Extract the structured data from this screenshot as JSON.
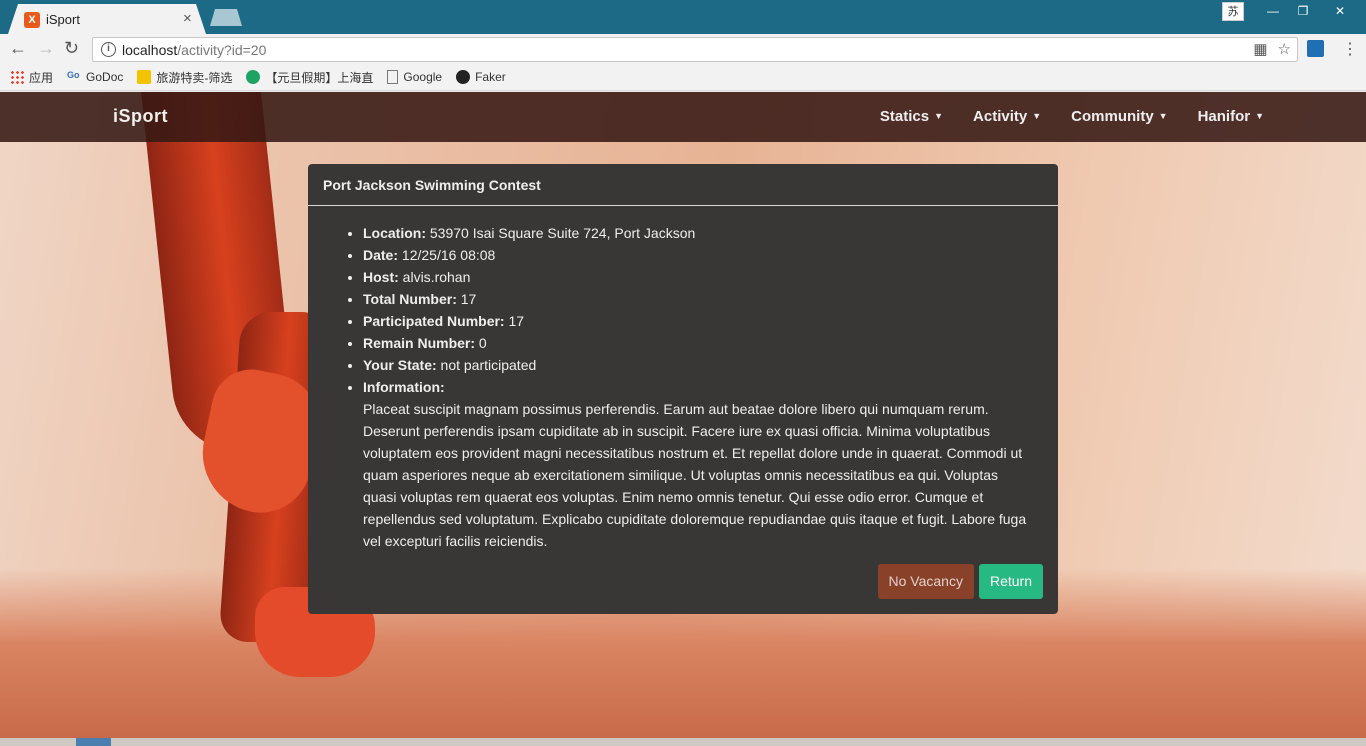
{
  "browser": {
    "tab_title": "iSport",
    "tab_favicon": "X",
    "tab_close": "×",
    "ime_label": "苏",
    "url_host": "localhost",
    "url_path": "/activity?id=20",
    "bookmarks": [
      {
        "label": "应用",
        "icon": "apps-grid-icon"
      },
      {
        "label": "GoDoc",
        "icon": "godoc-icon"
      },
      {
        "label": "旅游特卖-筛选",
        "icon": "travel-icon"
      },
      {
        "label": "【元旦假期】上海直",
        "icon": "green-icon"
      },
      {
        "label": "Google",
        "icon": "page-icon"
      },
      {
        "label": "Faker",
        "icon": "github-icon"
      }
    ]
  },
  "navbar": {
    "brand": "iSport",
    "items": [
      "Statics",
      "Activity",
      "Community",
      "Hanifor"
    ]
  },
  "panel": {
    "title": "Port Jackson Swimming Contest",
    "details": [
      {
        "label": "Location:",
        "value": "53970 Isai Square Suite 724, Port Jackson"
      },
      {
        "label": "Date:",
        "value": "12/25/16 08:08"
      },
      {
        "label": "Host:",
        "value": "alvis.rohan"
      },
      {
        "label": "Total Number:",
        "value": "17"
      },
      {
        "label": "Participated Number:",
        "value": "17"
      },
      {
        "label": "Remain Number:",
        "value": "0"
      },
      {
        "label": "Your State:",
        "value": "not participated"
      }
    ],
    "information_label": "Information:",
    "information_text": "Placeat suscipit magnam possimus perferendis. Earum aut beatae dolore libero qui numquam rerum. Deserunt perferendis ipsam cupiditate ab in suscipit. Facere iure ex quasi officia. Minima voluptatibus voluptatem eos provident magni necessitatibus nostrum et. Et repellat dolore unde in quaerat. Commodi ut quam asperiores neque ab exercitationem similique. Ut voluptas omnis necessitatibus ea qui. Voluptas quasi voluptas rem quaerat eos voluptas. Enim nemo omnis tenetur. Qui esse odio error. Cumque et repellendus sed voluptatum. Explicabo cupiditate doloremque repudiandae quis itaque et fugit. Labore fuga vel excepturi facilis reiciendis.",
    "buttons": {
      "no_vacancy": "No Vacancy",
      "return": "Return"
    }
  },
  "colors": {
    "navbar_bg": "#3a1c17",
    "panel_bg": "#393735",
    "no_vacancy_btn": "#8a412a",
    "return_btn": "#26b981",
    "browser_titlebar": "#1d6a86"
  }
}
